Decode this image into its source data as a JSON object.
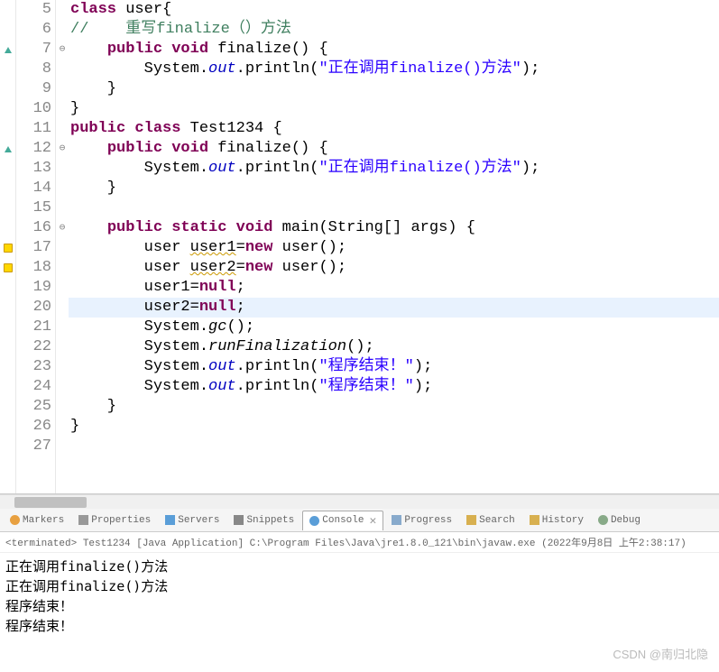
{
  "code": {
    "lines": [
      {
        "n": 5,
        "marker": "",
        "fold": "",
        "tokens": [
          {
            "t": "class ",
            "c": "kw"
          },
          {
            "t": "user{",
            "c": ""
          }
        ]
      },
      {
        "n": 6,
        "marker": "",
        "fold": "",
        "tokens": [
          {
            "t": "//    重写finalize（）方法",
            "c": "com"
          }
        ]
      },
      {
        "n": 7,
        "marker": "tri",
        "fold": "⊖",
        "tokens": [
          {
            "t": "    ",
            "c": ""
          },
          {
            "t": "public void ",
            "c": "kw"
          },
          {
            "t": "finalize() {",
            "c": ""
          }
        ]
      },
      {
        "n": 8,
        "marker": "",
        "fold": "",
        "tokens": [
          {
            "t": "        System.",
            "c": ""
          },
          {
            "t": "out",
            "c": "field"
          },
          {
            "t": ".println(",
            "c": ""
          },
          {
            "t": "\"正在调用finalize()方法\"",
            "c": "str"
          },
          {
            "t": ");",
            "c": ""
          }
        ]
      },
      {
        "n": 9,
        "marker": "",
        "fold": "",
        "tokens": [
          {
            "t": "    }",
            "c": ""
          }
        ]
      },
      {
        "n": 10,
        "marker": "",
        "fold": "",
        "tokens": [
          {
            "t": "}",
            "c": ""
          }
        ]
      },
      {
        "n": 11,
        "marker": "",
        "fold": "",
        "tokens": [
          {
            "t": "public class ",
            "c": "kw"
          },
          {
            "t": "Test1234 {",
            "c": ""
          }
        ]
      },
      {
        "n": 12,
        "marker": "tri",
        "fold": "⊖",
        "tokens": [
          {
            "t": "    ",
            "c": ""
          },
          {
            "t": "public void ",
            "c": "kw"
          },
          {
            "t": "finalize() {",
            "c": ""
          }
        ]
      },
      {
        "n": 13,
        "marker": "",
        "fold": "",
        "tokens": [
          {
            "t": "        System.",
            "c": ""
          },
          {
            "t": "out",
            "c": "field"
          },
          {
            "t": ".println(",
            "c": ""
          },
          {
            "t": "\"正在调用finalize()方法\"",
            "c": "str"
          },
          {
            "t": ");",
            "c": ""
          }
        ]
      },
      {
        "n": 14,
        "marker": "",
        "fold": "",
        "tokens": [
          {
            "t": "    }",
            "c": ""
          }
        ]
      },
      {
        "n": 15,
        "marker": "",
        "fold": "",
        "tokens": [
          {
            "t": "",
            "c": ""
          }
        ]
      },
      {
        "n": 16,
        "marker": "",
        "fold": "⊖",
        "tokens": [
          {
            "t": "    ",
            "c": ""
          },
          {
            "t": "public static void ",
            "c": "kw"
          },
          {
            "t": "main(String[] args) {",
            "c": ""
          }
        ]
      },
      {
        "n": 17,
        "marker": "warn",
        "fold": "",
        "tokens": [
          {
            "t": "        user ",
            "c": ""
          },
          {
            "t": "user1",
            "c": "warn-underline"
          },
          {
            "t": "=",
            "c": ""
          },
          {
            "t": "new ",
            "c": "kw"
          },
          {
            "t": "user();",
            "c": ""
          }
        ]
      },
      {
        "n": 18,
        "marker": "warn",
        "fold": "",
        "tokens": [
          {
            "t": "        user ",
            "c": ""
          },
          {
            "t": "user2",
            "c": "warn-underline"
          },
          {
            "t": "=",
            "c": ""
          },
          {
            "t": "new ",
            "c": "kw"
          },
          {
            "t": "user();",
            "c": ""
          }
        ]
      },
      {
        "n": 19,
        "marker": "",
        "fold": "",
        "tokens": [
          {
            "t": "        user1=",
            "c": ""
          },
          {
            "t": "null",
            "c": "kw"
          },
          {
            "t": ";",
            "c": ""
          }
        ]
      },
      {
        "n": 20,
        "marker": "",
        "fold": "",
        "hl": true,
        "tokens": [
          {
            "t": "        user2=",
            "c": ""
          },
          {
            "t": "null",
            "c": "kw"
          },
          {
            "t": ";",
            "c": ""
          }
        ]
      },
      {
        "n": 21,
        "marker": "",
        "fold": "",
        "tokens": [
          {
            "t": "        System.",
            "c": ""
          },
          {
            "t": "gc",
            "c": "static"
          },
          {
            "t": "();",
            "c": ""
          }
        ]
      },
      {
        "n": 22,
        "marker": "",
        "fold": "",
        "tokens": [
          {
            "t": "        System.",
            "c": ""
          },
          {
            "t": "runFinalization",
            "c": "static"
          },
          {
            "t": "();",
            "c": ""
          }
        ]
      },
      {
        "n": 23,
        "marker": "",
        "fold": "",
        "tokens": [
          {
            "t": "        System.",
            "c": ""
          },
          {
            "t": "out",
            "c": "field"
          },
          {
            "t": ".println(",
            "c": ""
          },
          {
            "t": "\"程序结束！\"",
            "c": "str"
          },
          {
            "t": ");",
            "c": ""
          }
        ]
      },
      {
        "n": 24,
        "marker": "",
        "fold": "",
        "tokens": [
          {
            "t": "        System.",
            "c": ""
          },
          {
            "t": "out",
            "c": "field"
          },
          {
            "t": ".println(",
            "c": ""
          },
          {
            "t": "\"程序结束！\"",
            "c": "str"
          },
          {
            "t": ");",
            "c": ""
          }
        ]
      },
      {
        "n": 25,
        "marker": "",
        "fold": "",
        "tokens": [
          {
            "t": "    }",
            "c": ""
          }
        ]
      },
      {
        "n": 26,
        "marker": "",
        "fold": "",
        "tokens": [
          {
            "t": "}",
            "c": ""
          }
        ]
      },
      {
        "n": 27,
        "marker": "",
        "fold": "",
        "tokens": [
          {
            "t": "",
            "c": ""
          }
        ]
      }
    ]
  },
  "tabs": [
    {
      "label": "Markers",
      "icon": "icon-marker"
    },
    {
      "label": "Properties",
      "icon": "icon-prop"
    },
    {
      "label": "Servers",
      "icon": "icon-server"
    },
    {
      "label": "Snippets",
      "icon": "icon-snip"
    },
    {
      "label": "Console",
      "icon": "icon-console",
      "active": true,
      "close": "✕"
    },
    {
      "label": "Progress",
      "icon": "icon-progress"
    },
    {
      "label": "Search",
      "icon": "icon-search"
    },
    {
      "label": "History",
      "icon": "icon-history"
    },
    {
      "label": "Debug",
      "icon": "icon-debug"
    }
  ],
  "console": {
    "info": "<terminated> Test1234 [Java Application] C:\\Program Files\\Java\\jre1.8.0_121\\bin\\javaw.exe (2022年9月8日 上午2:38:17)",
    "output": [
      "正在调用finalize()方法",
      "正在调用finalize()方法",
      "程序结束！",
      "程序结束！"
    ]
  },
  "watermark": "CSDN @南归北隐"
}
